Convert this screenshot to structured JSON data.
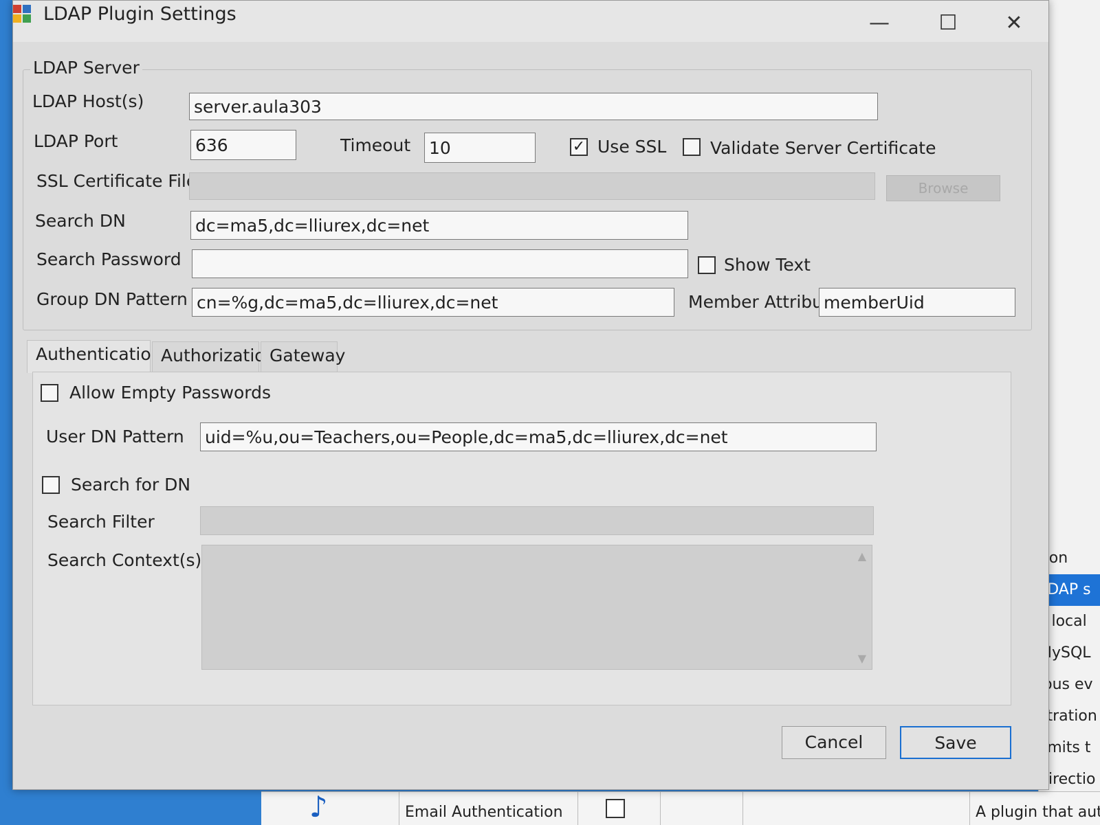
{
  "dialog": {
    "title": "LDAP Plugin Settings",
    "minimize": "—",
    "maximize": "☐",
    "close": "✕"
  },
  "server": {
    "group_title": "LDAP Server",
    "host_label": "LDAP Host(s)",
    "host_value": "server.aula303",
    "port_label": "LDAP Port",
    "port_value": "636",
    "timeout_label": "Timeout",
    "timeout_value": "10",
    "use_ssl_label": "Use SSL",
    "use_ssl_checked": "✓",
    "validate_cert_label": "Validate Server Certificate",
    "ssl_cert_label": "SSL Certificate File",
    "ssl_cert_value": "",
    "browse_label": "Browse",
    "search_dn_label": "Search DN",
    "search_dn_value": "dc=ma5,dc=lliurex,dc=net",
    "search_password_label": "Search Password",
    "search_password_value": "",
    "show_text_label": "Show Text",
    "group_dn_label": "Group DN Pattern",
    "group_dn_value": "cn=%g,dc=ma5,dc=lliurex,dc=net",
    "member_attr_label": "Member Attribute",
    "member_attr_value": "memberUid"
  },
  "tabs": [
    "Authentication",
    "Authorization",
    "Gateway"
  ],
  "auth": {
    "allow_empty_label": "Allow Empty Passwords",
    "user_dn_label": "User DN Pattern",
    "user_dn_value": "uid=%u,ou=Teachers,ou=People,dc=ma5,dc=lliurex,dc=net",
    "search_for_dn_label": "Search for DN",
    "search_filter_label": "Search Filter",
    "search_filter_value": "",
    "search_context_label": "Search Context(s)"
  },
  "buttons": {
    "cancel": "Cancel",
    "save": "Save"
  },
  "background": {
    "list": [
      "tion",
      "LDAP s",
      "s local",
      "MySQL",
      "ious ev",
      "stration",
      "limits t",
      "directio"
    ],
    "row_email": "Email Authentication",
    "row_desc": "A plugin that aut"
  }
}
